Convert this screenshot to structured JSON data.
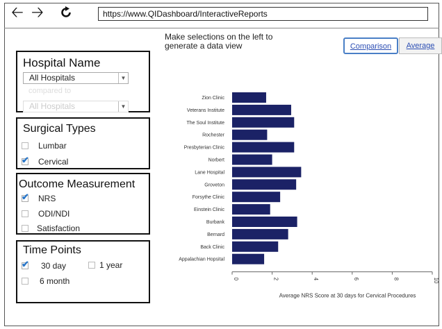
{
  "browser": {
    "url": "https://www.QIDashboard/InteractiveReports"
  },
  "instructions": "Make selections on the left to generate a data view",
  "tabs": {
    "comparison": "Comparison",
    "average": "Average"
  },
  "hospital_panel": {
    "title": "Hospital Name",
    "primary_select": "All Hospitals",
    "compared_to": "compared to",
    "secondary_select": "All Hospitals"
  },
  "surgical_panel": {
    "title": "Surgical Types",
    "options": [
      {
        "label": "Lumbar",
        "checked": false
      },
      {
        "label": "Cervical",
        "checked": true
      }
    ]
  },
  "outcome_panel": {
    "title": "Outcome Measurement",
    "options": [
      {
        "label": "NRS",
        "checked": true
      },
      {
        "label": "ODI/NDI",
        "checked": false
      },
      {
        "label": "Satisfaction",
        "checked": false
      }
    ]
  },
  "time_panel": {
    "title": "Time Points",
    "options": [
      {
        "label": "30 day",
        "checked": true
      },
      {
        "label": "1 year",
        "checked": false
      },
      {
        "label": "6 month",
        "checked": false
      }
    ]
  },
  "colors": {
    "bar": "#1b2266",
    "accent": "#2b4db3"
  },
  "chart_data": {
    "type": "bar",
    "orientation": "horizontal",
    "categories": [
      "Zion Clinic",
      "Veterans Institute",
      "The Soul Institute",
      "Rochester",
      "Presbyterian Clinic",
      "Norbert",
      "Lane Hospital",
      "Groveton",
      "Forsythe Clinic",
      "Einstein Clinic",
      "Burbank",
      "Bernard",
      "Back Clinic",
      "Appalachian Hopsital"
    ],
    "values": [
      1.7,
      2.95,
      3.1,
      1.75,
      3.1,
      2.0,
      3.45,
      3.2,
      2.4,
      1.9,
      3.25,
      2.8,
      2.3,
      1.6
    ],
    "xlim": [
      0,
      10
    ],
    "xticks": [
      0,
      2,
      4,
      6,
      8,
      10
    ],
    "xlabel": "Average NRS Score at 30 days for Cervical Procedures",
    "ylabel": "",
    "title": "",
    "grid": false,
    "legend": "none"
  }
}
